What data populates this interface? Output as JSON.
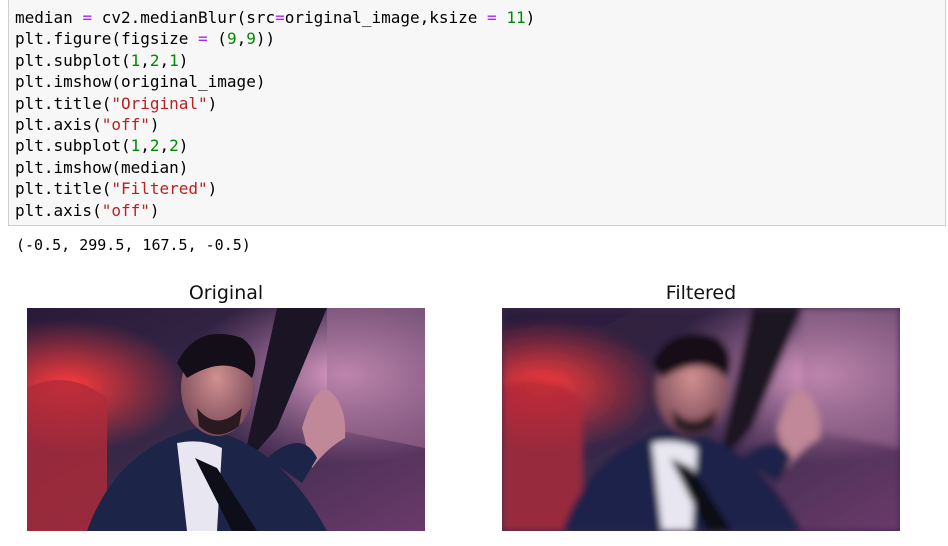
{
  "cell": {
    "code_lines": [
      [
        {
          "t": "median "
        },
        {
          "t": "=",
          "c": "op"
        },
        {
          "t": " cv2.medianBlur(src"
        },
        {
          "t": "=",
          "c": "op"
        },
        {
          "t": "original_image,ksize "
        },
        {
          "t": "=",
          "c": "op"
        },
        {
          "t": " "
        },
        {
          "t": "11",
          "c": "num"
        },
        {
          "t": ")"
        }
      ],
      [
        {
          "t": "plt.figure(figsize "
        },
        {
          "t": "=",
          "c": "op"
        },
        {
          "t": " ("
        },
        {
          "t": "9",
          "c": "num"
        },
        {
          "t": ","
        },
        {
          "t": "9",
          "c": "num"
        },
        {
          "t": "))"
        }
      ],
      [
        {
          "t": "plt.subplot("
        },
        {
          "t": "1",
          "c": "num"
        },
        {
          "t": ","
        },
        {
          "t": "2",
          "c": "num"
        },
        {
          "t": ","
        },
        {
          "t": "1",
          "c": "num"
        },
        {
          "t": ")"
        }
      ],
      [
        {
          "t": "plt.imshow(original_image)"
        }
      ],
      [
        {
          "t": "plt.title("
        },
        {
          "t": "\"Original\"",
          "c": "str"
        },
        {
          "t": ")"
        }
      ],
      [
        {
          "t": "plt.axis("
        },
        {
          "t": "\"off\"",
          "c": "str"
        },
        {
          "t": ")"
        }
      ],
      [
        {
          "t": "plt.subplot("
        },
        {
          "t": "1",
          "c": "num"
        },
        {
          "t": ","
        },
        {
          "t": "2",
          "c": "num"
        },
        {
          "t": ","
        },
        {
          "t": "2",
          "c": "num"
        },
        {
          "t": ")"
        }
      ],
      [
        {
          "t": "plt.imshow(median)"
        }
      ],
      [
        {
          "t": "plt.title("
        },
        {
          "t": "\"Filtered\"",
          "c": "str"
        },
        {
          "t": ")"
        }
      ],
      [
        {
          "t": "plt.axis("
        },
        {
          "t": "\"off\"",
          "c": "str"
        },
        {
          "t": ")"
        }
      ]
    ],
    "output_text": "(-0.5, 299.5, 167.5, -0.5)"
  },
  "figures": {
    "left": {
      "title": "Original",
      "image": "portrait-photo",
      "blurred": false
    },
    "right": {
      "title": "Filtered",
      "image": "portrait-photo-median-filtered",
      "blurred": true
    }
  },
  "colors": {
    "keyword_operator": "#aa22ff",
    "number": "#008800",
    "string": "#ba2121",
    "cell_background": "#f7f7f7"
  }
}
